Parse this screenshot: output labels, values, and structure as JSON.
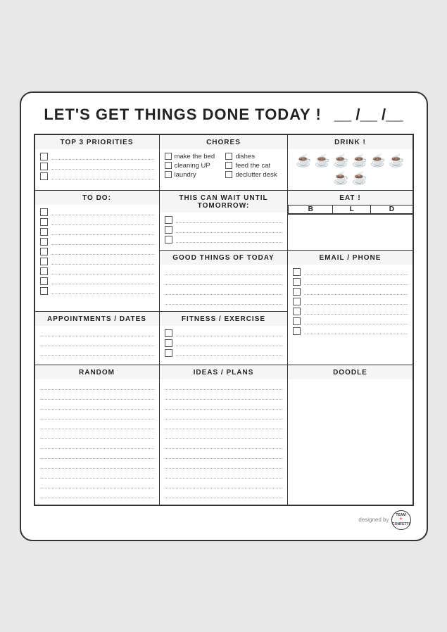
{
  "title": "LET'S GET THINGS DONE TODAY !",
  "date_field": "__ /__ /__",
  "sections": {
    "top3": {
      "header": "TOP 3 PRIORITIES",
      "items": [
        "",
        "",
        ""
      ]
    },
    "chores": {
      "header": "CHORES",
      "items": [
        "make the bed",
        "cleaning UP",
        "laundry",
        "dishes",
        "feed the cat",
        "declutter desk"
      ]
    },
    "drink": {
      "header": "DRINK !",
      "mug_count": 8
    },
    "todo": {
      "header": "TO DO:",
      "items": [
        "",
        "",
        "",
        "",
        "",
        "",
        "",
        "",
        ""
      ]
    },
    "wait": {
      "header": "THIS CAN WAIT UNTIL TOMORROW:",
      "items": [
        "",
        "",
        ""
      ]
    },
    "eat": {
      "header": "EAT !",
      "cols": [
        "B",
        "L",
        "D"
      ]
    },
    "good_things": {
      "header": "GOOD THINGS OF TODAY",
      "lines": 4
    },
    "email_phone": {
      "header": "EMAIL / PHONE",
      "items": [
        "",
        "",
        "",
        "",
        "",
        "",
        ""
      ]
    },
    "appointments": {
      "header": "APPOINTMENTS / DATES",
      "lines": 3
    },
    "fitness": {
      "header": "FITNESS / EXERCISE",
      "items": [
        "",
        "",
        ""
      ]
    },
    "random": {
      "header": "RANDOM",
      "lines": 12
    },
    "ideas": {
      "header": "IDEAS / PLANS",
      "lines": 12
    },
    "doodle": {
      "header": "DOODLE"
    }
  },
  "footer": {
    "designed_by": "designed by",
    "brand": "TEAM\nCONFETTI"
  }
}
